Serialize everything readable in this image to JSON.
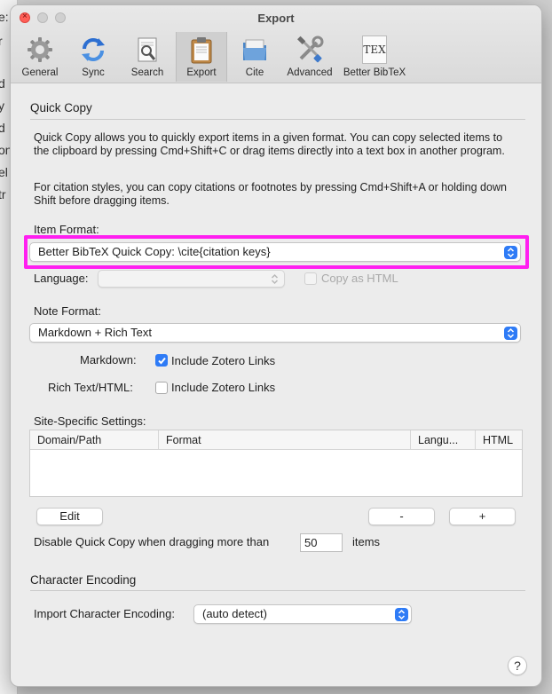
{
  "background_window": {
    "fragments": [
      "e:",
      "r",
      "d",
      "y",
      "d",
      "on",
      "el",
      "tr"
    ]
  },
  "window": {
    "title": "Export"
  },
  "toolbar": {
    "items": [
      {
        "label": "General",
        "icon": "gear-icon"
      },
      {
        "label": "Sync",
        "icon": "sync-icon"
      },
      {
        "label": "Search",
        "icon": "search-icon"
      },
      {
        "label": "Export",
        "icon": "clipboard-icon",
        "active": true
      },
      {
        "label": "Cite",
        "icon": "folder-icon"
      },
      {
        "label": "Advanced",
        "icon": "tools-icon"
      },
      {
        "label": "Better BibTeX",
        "icon": "tex-icon",
        "icon_text": "TEX"
      }
    ]
  },
  "quick_copy": {
    "title": "Quick Copy",
    "description1": "Quick Copy allows you to quickly export items in a given format. You can copy selected items to the clipboard by pressing Cmd+Shift+C or drag items directly into a text box in another program.",
    "description2": "For citation styles, you can copy citations or footnotes by pressing Cmd+Shift+A or holding down Shift before dragging items.",
    "item_format_label": "Item Format:",
    "item_format_value": "Better BibTeX Quick Copy: \\cite{citation keys}",
    "language_label": "Language:",
    "language_value": "",
    "copy_as_html_label": "Copy as HTML",
    "note_format_label": "Note Format:",
    "note_format_value": "Markdown + Rich Text",
    "markdown_label": "Markdown:",
    "markdown_checkbox_label": "Include Zotero Links",
    "markdown_checked": true,
    "richtext_label": "Rich Text/HTML:",
    "richtext_checkbox_label": "Include Zotero Links",
    "richtext_checked": false,
    "site_specific_label": "Site-Specific Settings:",
    "table_columns": [
      "Domain/Path",
      "Format",
      "Langu...",
      "HTML"
    ],
    "edit_button": "Edit",
    "remove_button": "-",
    "add_button": "+",
    "disable_label": "Disable Quick Copy when dragging more than",
    "disable_value": "50",
    "items_label": "items"
  },
  "character_encoding": {
    "title": "Character Encoding",
    "import_label": "Import Character Encoding:",
    "import_value": "(auto detect)"
  },
  "help_button": "?",
  "colors": {
    "accent": "#2e7bf6",
    "highlight": "#ff1ff0",
    "close": "#ff5f57"
  }
}
